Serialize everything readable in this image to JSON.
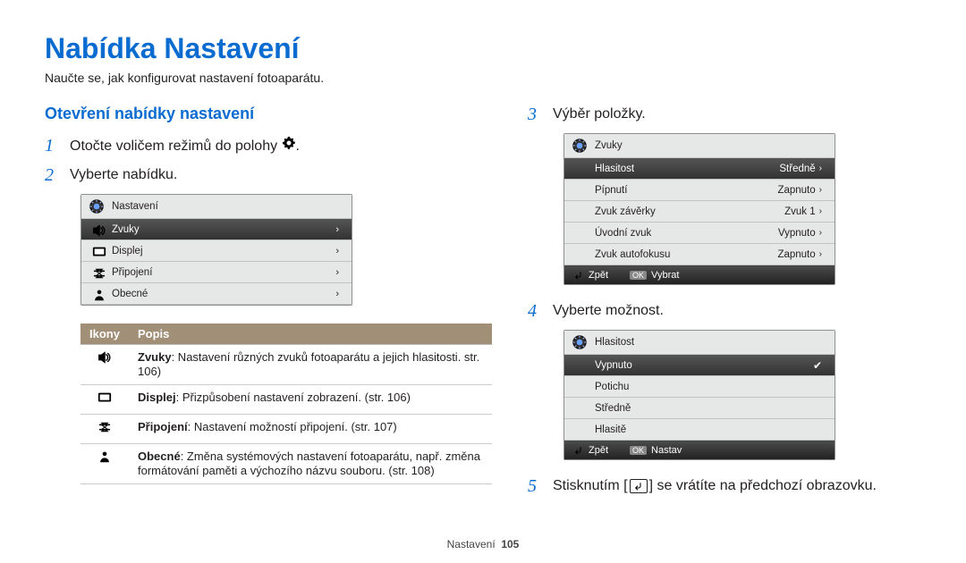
{
  "title": "Nabídka Nastavení",
  "intro": "Naučte se, jak konfigurovat nastavení fotoaparátu.",
  "subhead": "Otevření nabídky nastavení",
  "steps": {
    "s1": "Otočte voličem režimů do polohy ",
    "s1b": ".",
    "s2": "Vyberte nabídku.",
    "s3": "Výběr položky.",
    "s4": "Vyberte možnost.",
    "s5a": "Stisknutím [",
    "s5b": "] se vrátíte na předchozí obrazovku."
  },
  "panel1": {
    "header": "Nastavení",
    "rows": [
      "Zvuky",
      "Displej",
      "Připojení",
      "Obecné"
    ]
  },
  "panel2": {
    "header": "Zvuky",
    "rows": [
      {
        "l": "Hlasitost",
        "r": "Středně"
      },
      {
        "l": "Pípnutí",
        "r": "Zapnuto"
      },
      {
        "l": "Zvuk závěrky",
        "r": "Zvuk 1"
      },
      {
        "l": "Úvodní zvuk",
        "r": "Vypnuto"
      },
      {
        "l": "Zvuk autofokusu",
        "r": "Zapnuto"
      }
    ],
    "ft": {
      "back": "Zpět",
      "ok": "Vybrat",
      "okkey": "OK"
    }
  },
  "panel3": {
    "header": "Hlasitost",
    "rows": [
      "Vypnuto",
      "Potichu",
      "Středně",
      "Hlasitě"
    ],
    "selected": 0,
    "ft": {
      "back": "Zpět",
      "ok": "Nastav",
      "okkey": "OK"
    }
  },
  "table": {
    "th_icon": "Ikony",
    "th_desc": "Popis",
    "rows": [
      {
        "k": "sound",
        "b": "Zvuky",
        "t": ": Nastavení různých zvuků fotoaparátu a jejich hlasitosti. str. 106)"
      },
      {
        "k": "display",
        "b": "Displej",
        "t": ": Přizpůsobení nastavení zobrazení. (str. 106)"
      },
      {
        "k": "conn",
        "b": "Připojení",
        "t": ": Nastavení možností připojení. (str. 107)"
      },
      {
        "k": "general",
        "b": "Obecné",
        "t": ": Změna systémových nastavení fotoaparátu, např. změna formátování paměti a výchozího názvu souboru. (str. 108)"
      }
    ]
  },
  "footer": {
    "label": "Nastavení",
    "page": "105"
  }
}
